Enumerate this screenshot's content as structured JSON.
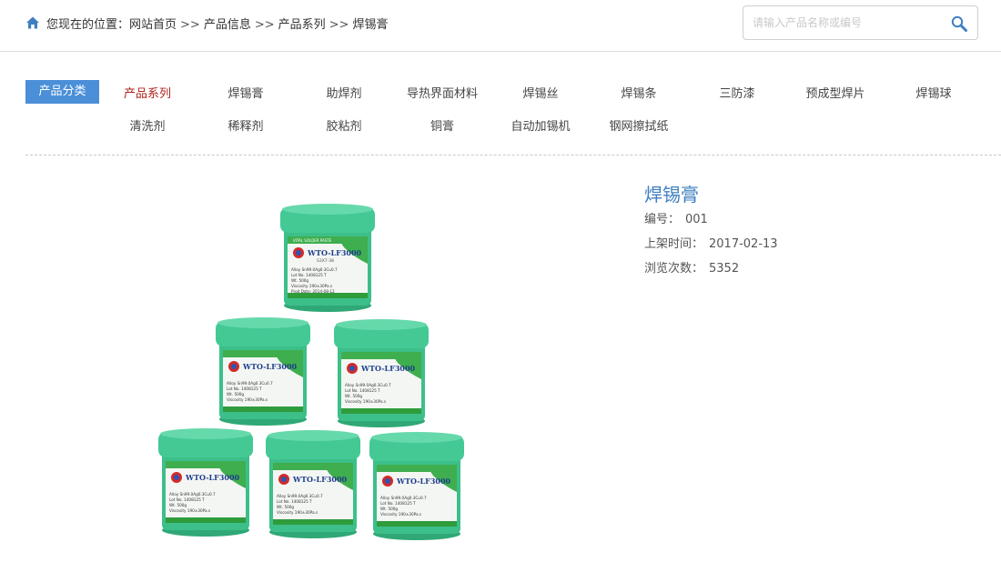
{
  "breadcrumb": {
    "prefix": "您现在的位置：",
    "separator": ">>",
    "items": [
      "网站首页",
      "产品信息",
      "产品系列",
      "焊锡膏"
    ]
  },
  "search": {
    "placeholder": "请输入产品名称或编号"
  },
  "categories": {
    "label": "产品分类",
    "row1": [
      "产品系列",
      "焊锡膏",
      "助焊剂",
      "导热界面材料",
      "焊锡丝",
      "焊锡条",
      "三防漆",
      "预成型焊片",
      "焊锡球"
    ],
    "row2": [
      "清洗剂",
      "稀释剂",
      "胶粘剂",
      "铜膏",
      "自动加锡机",
      "钢网擦拭纸"
    ]
  },
  "product": {
    "title": "焊锡膏",
    "code_label": "编号：",
    "code": "001",
    "date_label": "上架时间：",
    "date": "2017-02-13",
    "views_label": "浏览次数：",
    "views": "5352",
    "jar": {
      "label_title": "VITAL SOLDER PASTE",
      "model": "WTO-LF3000",
      "sub": "S3X7-38",
      "lines": [
        "Alloy  Sn99.0Ag0.3Cu0.7",
        "Lot No.  1408125 T",
        "Wt.   500g",
        "Viscosity  190±30Pa.s",
        "Prod Date:  2014-08-12"
      ]
    }
  },
  "colors": {
    "accent": "#4a8fd8",
    "active": "#b0221e",
    "title": "#3f7fc1",
    "jar": "#3dbf8a"
  }
}
